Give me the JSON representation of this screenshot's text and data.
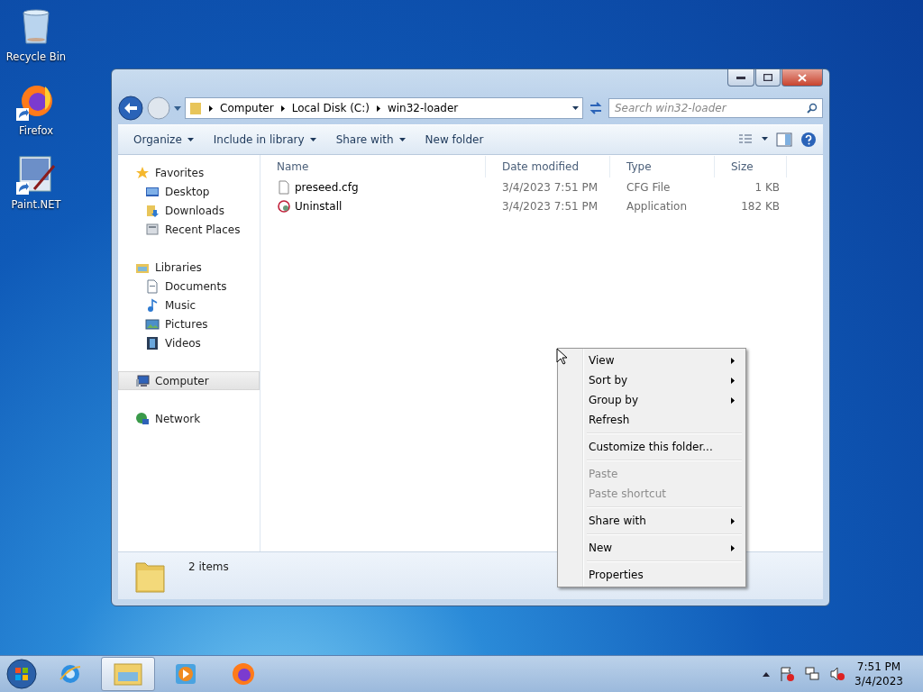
{
  "desktop_icons": [
    {
      "label": "Recycle Bin",
      "kind": "recycle",
      "shortcut": false
    },
    {
      "label": "Firefox",
      "kind": "firefox",
      "shortcut": true
    },
    {
      "label": "Paint.NET",
      "kind": "paint",
      "shortcut": true
    }
  ],
  "window": {
    "address": [
      "Computer",
      "Local Disk (C:)",
      "win32-loader"
    ],
    "search": {
      "placeholder": "Search win32-loader"
    },
    "toolbar": [
      {
        "label": "Organize",
        "dropdown": true
      },
      {
        "label": "Include in library",
        "dropdown": true
      },
      {
        "label": "Share with",
        "dropdown": true
      },
      {
        "label": "New folder",
        "dropdown": false
      }
    ],
    "sidebar": [
      {
        "label": "Favorites",
        "kind": "star",
        "selected": false,
        "children": [
          {
            "label": "Desktop",
            "kind": "desktop",
            "selected": false
          },
          {
            "label": "Downloads",
            "kind": "downloads",
            "selected": false
          },
          {
            "label": "Recent Places",
            "kind": "recent",
            "selected": false
          }
        ]
      },
      {
        "label": "Libraries",
        "kind": "libraries",
        "selected": false,
        "children": [
          {
            "label": "Documents",
            "kind": "documents",
            "selected": false
          },
          {
            "label": "Music",
            "kind": "music",
            "selected": false
          },
          {
            "label": "Pictures",
            "kind": "pictures",
            "selected": false
          },
          {
            "label": "Videos",
            "kind": "videos",
            "selected": false
          }
        ]
      },
      {
        "label": "Computer",
        "kind": "computer",
        "selected": true
      },
      {
        "label": "Network",
        "kind": "network",
        "selected": false
      }
    ],
    "columns": [
      "Name",
      "Date modified",
      "Type",
      "Size"
    ],
    "files": [
      {
        "name": "preseed.cfg",
        "kind": "file",
        "date": "3/4/2023 7:51 PM",
        "type": "CFG File",
        "size": "1 KB"
      },
      {
        "name": "Uninstall",
        "kind": "app",
        "date": "3/4/2023 7:51 PM",
        "type": "Application",
        "size": "182 KB"
      }
    ],
    "status": "2 items"
  },
  "context_menu": [
    {
      "kind": "item",
      "label": "View",
      "submenu": true,
      "disabled": false
    },
    {
      "kind": "item",
      "label": "Sort by",
      "submenu": true,
      "disabled": false
    },
    {
      "kind": "item",
      "label": "Group by",
      "submenu": true,
      "disabled": false
    },
    {
      "kind": "item",
      "label": "Refresh",
      "submenu": false,
      "disabled": false
    },
    {
      "kind": "separator"
    },
    {
      "kind": "item",
      "label": "Customize this folder...",
      "submenu": false,
      "disabled": false
    },
    {
      "kind": "separator"
    },
    {
      "kind": "item",
      "label": "Paste",
      "submenu": false,
      "disabled": true
    },
    {
      "kind": "item",
      "label": "Paste shortcut",
      "submenu": false,
      "disabled": true
    },
    {
      "kind": "separator"
    },
    {
      "kind": "item",
      "label": "Share with",
      "submenu": true,
      "disabled": false
    },
    {
      "kind": "separator"
    },
    {
      "kind": "item",
      "label": "New",
      "submenu": true,
      "disabled": false
    },
    {
      "kind": "separator"
    },
    {
      "kind": "item",
      "label": "Properties",
      "submenu": false,
      "disabled": false
    }
  ],
  "taskbar": {
    "apps": [
      {
        "kind": "ie",
        "selected": false
      },
      {
        "kind": "explorer",
        "selected": true
      },
      {
        "kind": "media",
        "selected": false
      },
      {
        "kind": "firefox",
        "selected": false
      }
    ],
    "clock": {
      "time": "7:51 PM",
      "date": "3/4/2023"
    }
  }
}
